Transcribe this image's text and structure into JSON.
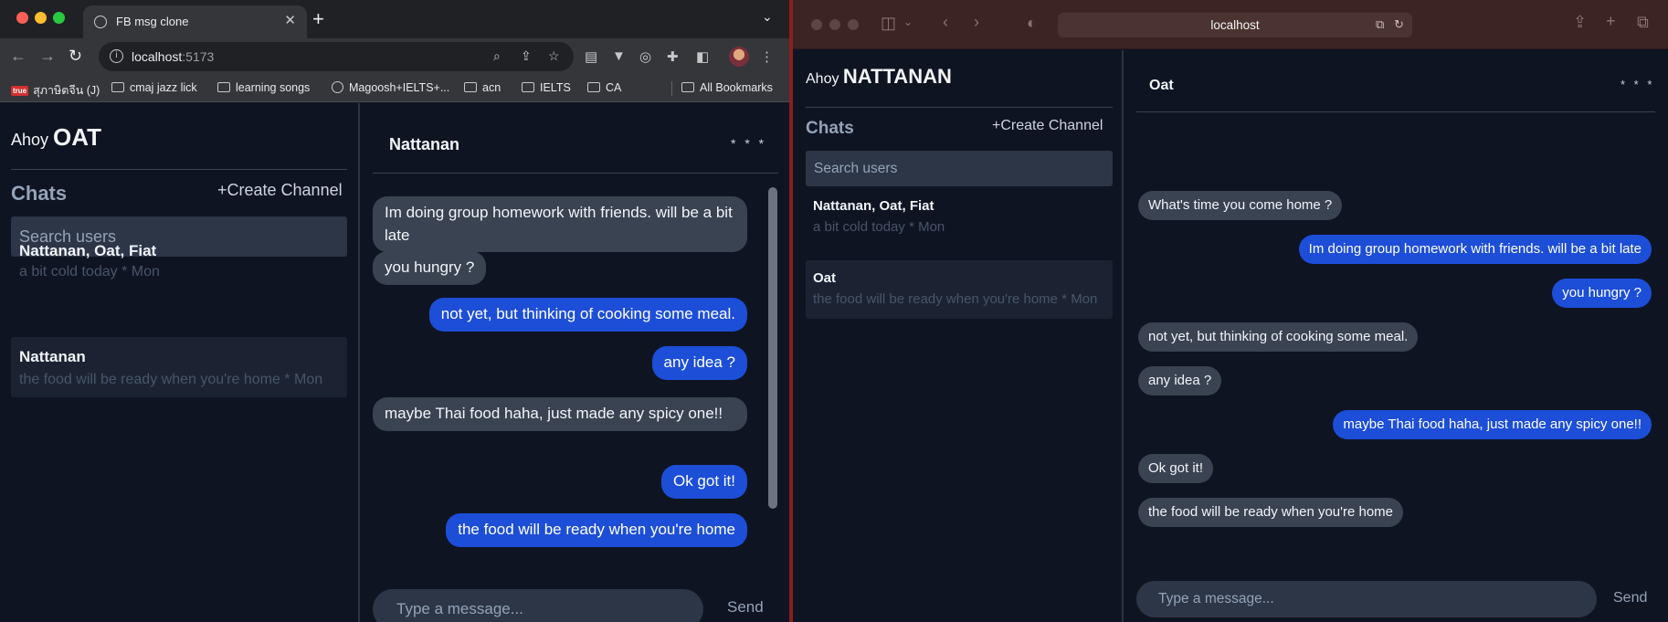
{
  "chrome": {
    "tab_title": "FB msg clone",
    "url_host": "localhost",
    "url_port": ":5173",
    "bookmarks": [
      "สุภาษิตจีน (J)",
      "cmaj jazz lick",
      "learning songs",
      "Magoosh+IELTS+...",
      "acn",
      "IELTS",
      "CA",
      "All Bookmarks"
    ],
    "app": {
      "greeting": "Ahoy",
      "username": "OAT",
      "chats_title": "Chats",
      "create_channel": "+Create Channel",
      "search_placeholder": "Search users",
      "chat_list": [
        {
          "name": "Nattanan, Oat, Fiat",
          "preview": "a bit cold today * Mon"
        },
        {
          "name": "Nattanan",
          "preview": "the food will be ready when you're home * Mon"
        }
      ],
      "header_name": "Nattanan",
      "dots": "* * *",
      "messages": [
        {
          "from": "them",
          "text": "Im doing group homework with friends. will be a bit late"
        },
        {
          "from": "them",
          "text": "you hungry ?"
        },
        {
          "from": "me",
          "text": "not yet, but thinking of cooking some meal."
        },
        {
          "from": "me",
          "text": "any idea ?"
        },
        {
          "from": "them",
          "text": "maybe Thai food haha, just made any spicy one!!"
        },
        {
          "from": "me",
          "text": "Ok got it!"
        },
        {
          "from": "me",
          "text": "the food will be ready when you're home"
        }
      ],
      "input_placeholder": "Type a message...",
      "send_label": "Send"
    }
  },
  "safari": {
    "url": "localhost",
    "app": {
      "greeting": "Ahoy",
      "username": "NATTANAN",
      "chats_title": "Chats",
      "create_channel": "+Create Channel",
      "search_placeholder": "Search users",
      "chat_list": [
        {
          "name": "Nattanan, Oat, Fiat",
          "preview": "a bit cold today * Mon"
        },
        {
          "name": "Oat",
          "preview": "the food will be ready when you're home * Mon"
        }
      ],
      "header_name": "Oat",
      "dots": "* * *",
      "messages": [
        {
          "from": "them",
          "text": "What's time you come home ?"
        },
        {
          "from": "me",
          "text": "Im doing group homework with friends. will be a bit late"
        },
        {
          "from": "me",
          "text": "you hungry ?"
        },
        {
          "from": "them",
          "text": "not yet, but thinking of cooking some meal."
        },
        {
          "from": "them",
          "text": "any idea ?"
        },
        {
          "from": "me",
          "text": "maybe Thai food haha, just made any spicy one!!"
        },
        {
          "from": "them",
          "text": "Ok got it!"
        },
        {
          "from": "them",
          "text": "the food will be ready when you're home"
        }
      ],
      "input_placeholder": "Type a message...",
      "send_label": "Send"
    }
  },
  "colors": {
    "app_bg": "#0f1422",
    "bubble_out": "#1d4ed8",
    "bubble_in": "#3a4352",
    "search_bg": "#2c3647"
  }
}
